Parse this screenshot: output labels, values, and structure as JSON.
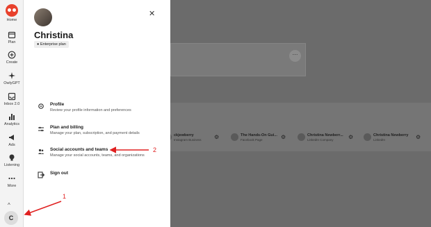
{
  "rail": {
    "items": [
      {
        "label": "Home",
        "icon": "owl-logo-icon"
      },
      {
        "label": "Plan",
        "icon": "calendar-icon"
      },
      {
        "label": "Create",
        "icon": "plus-circle-icon"
      },
      {
        "label": "OwlyGPT",
        "icon": "sparkle-icon"
      },
      {
        "label": "Inbox 2.0",
        "icon": "inbox-icon"
      },
      {
        "label": "Analytics",
        "icon": "bar-chart-icon"
      },
      {
        "label": "Ads",
        "icon": "megaphone-icon"
      },
      {
        "label": "Listening",
        "icon": "lightbulb-icon"
      },
      {
        "label": "More",
        "icon": "ellipsis-icon"
      }
    ],
    "avatar_initial": "C"
  },
  "drawer": {
    "name": "Christina",
    "plan": "Enterprise plan",
    "menu": [
      {
        "title": "Profile",
        "desc": "Review your profile information and preferences"
      },
      {
        "title": "Plan and billing",
        "desc": "Manage your plan, subscription, and payment details"
      },
      {
        "title": "Social accounts and teams",
        "desc": "Manage your social accounts, teams, and organizations"
      },
      {
        "title": "Sign out",
        "desc": ""
      }
    ]
  },
  "accounts": [
    {
      "name": "ckjewberry",
      "sub": "Instagram Business"
    },
    {
      "name": "The Hands-On Gui...",
      "sub": "Facebook Page"
    },
    {
      "name": "Christina Newberr...",
      "sub": "LinkedIn Company"
    },
    {
      "name": "Christina Newberry",
      "sub": "LinkedIn"
    }
  ],
  "annotations": {
    "one": "1",
    "two": "2",
    "color": "#e02020"
  }
}
